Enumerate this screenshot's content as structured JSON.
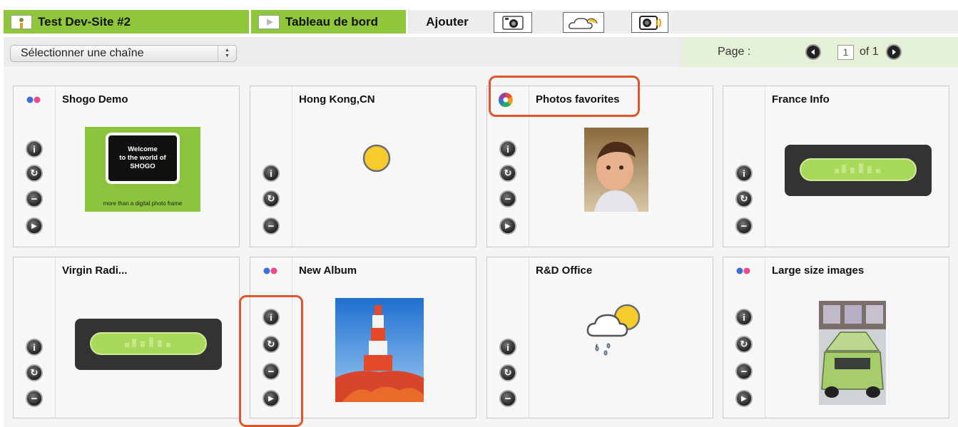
{
  "header": {
    "site_tab": "Test Dev-Site #2",
    "dashboard_tab": "Tableau de bord",
    "add_label": "Ajouter",
    "tools": [
      "add-photo-icon",
      "add-weather-icon",
      "add-radio-icon"
    ]
  },
  "selector": {
    "value": "Sélectionner une chaîne"
  },
  "pager": {
    "label": "Page :",
    "current": "1",
    "of": "of 1"
  },
  "accent_color": "#8fc63a",
  "highlight_color": "#e2542a",
  "cards": [
    {
      "title": "Shogo Demo",
      "source": "flickr",
      "thumbnail": "shogo-welcome"
    },
    {
      "title": "Hong Kong,CN",
      "source": "none",
      "thumbnail": "sun"
    },
    {
      "title": "Photos favorites",
      "source": "picasa",
      "thumbnail": "child-photo"
    },
    {
      "title": "France Info",
      "source": "none",
      "thumbnail": "radio"
    },
    {
      "title": "Virgin Radi...",
      "source": "none",
      "thumbnail": "radio"
    },
    {
      "title": "New Album",
      "source": "flickr",
      "thumbnail": "human-tower-photo"
    },
    {
      "title": "R&D Office",
      "source": "none",
      "thumbnail": "rain-sun"
    },
    {
      "title": "Large size images",
      "source": "flickr",
      "thumbnail": "car-photo"
    }
  ],
  "shogo_thumb": {
    "line1": "Welcome",
    "line2": "to the world of",
    "line3": "SHOGO",
    "footer": "more than a digital photo frame"
  }
}
